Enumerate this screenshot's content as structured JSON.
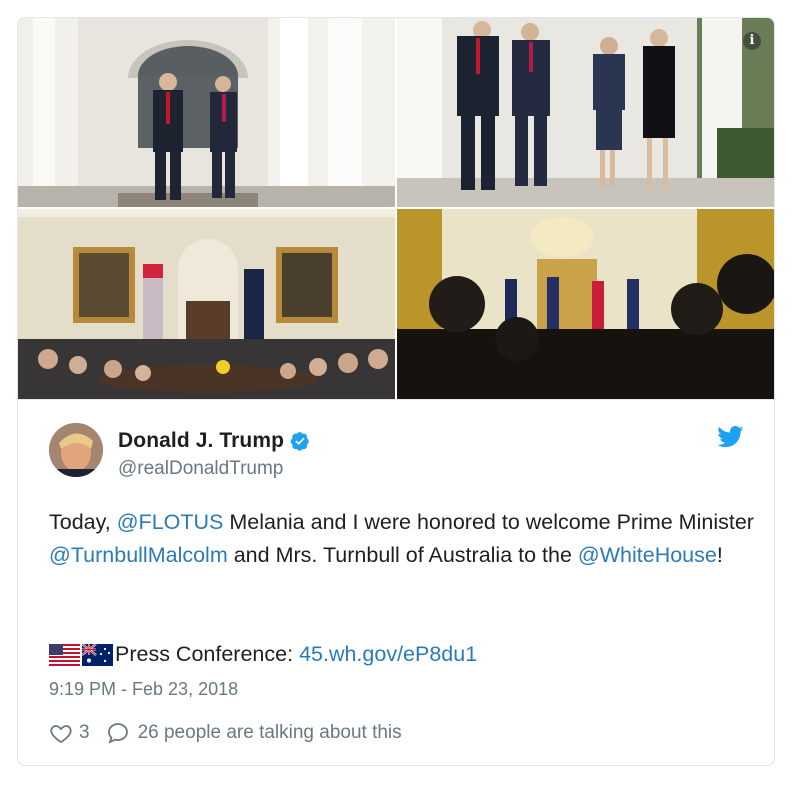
{
  "tweet": {
    "author_name": "Donald J. Trump",
    "handle": "@realDonaldTrump",
    "text_parts": {
      "p1": "Today, ",
      "m1": "@FLOTUS",
      "p2": " Melania and I were honored to welcome Prime Minister ",
      "m2": "@TurnbullMalcolm",
      "p3": " and Mrs. Turnbull of Australia to the ",
      "m3": "@WhiteHouse",
      "p4": "!"
    },
    "press_label": "Press Conference: ",
    "press_link": "45.wh.gov/eP8du1",
    "timestamp": "9:19 PM - Feb 23, 2018",
    "likes": "3",
    "talking": "26 people are talking about this"
  },
  "icons": {
    "info": "info-icon",
    "verified": "verified-badge-icon",
    "twitter": "twitter-bird-icon",
    "like": "heart-icon",
    "reply": "speech-bubble-icon",
    "flags": [
      "us-flag-emoji",
      "australia-flag-emoji"
    ]
  },
  "colors": {
    "link": "#2b7bb9",
    "twitter_blue": "#1da1f2",
    "muted": "#697882",
    "text": "#1c2022",
    "border": "#e1e8ed"
  }
}
